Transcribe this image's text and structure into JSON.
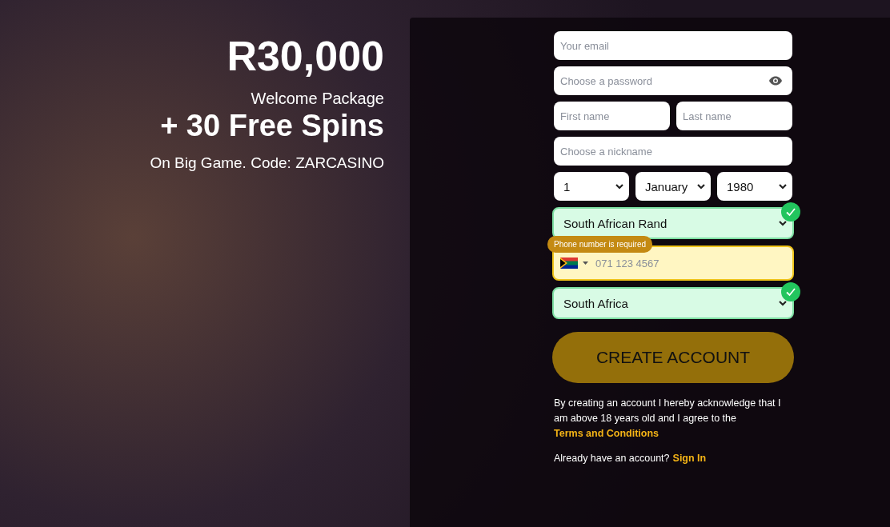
{
  "promo": {
    "amount": "R30,000",
    "subtitle": "Welcome Package",
    "spins": "+ 30 Free Spins",
    "code_line": "On Big Game. Code: ZARCASINO"
  },
  "form": {
    "rows": [
      [
        {
          "kind": "text",
          "placeholder": "Your email"
        }
      ],
      [
        {
          "kind": "password",
          "placeholder": "Choose a password"
        }
      ],
      [
        {
          "kind": "text",
          "placeholder": "First name"
        },
        {
          "kind": "text",
          "placeholder": "Last name"
        }
      ],
      [
        {
          "kind": "text",
          "placeholder": "Choose a nickname"
        }
      ],
      [
        {
          "kind": "select",
          "value": "1",
          "valid": false
        },
        {
          "kind": "select",
          "value": "January",
          "valid": false
        },
        {
          "kind": "select",
          "value": "1980",
          "valid": false
        }
      ],
      [
        {
          "kind": "select",
          "value": "South African Rand",
          "valid": true
        }
      ],
      [
        {
          "kind": "phone",
          "placeholder": "071 123 4567",
          "error": "Phone number is required"
        }
      ],
      [
        {
          "kind": "select",
          "value": "South Africa",
          "valid": true
        }
      ]
    ],
    "submit": "CREATE ACCOUNT",
    "terms": {
      "text": "By creating an account I hereby acknowledge that I am above 18 years old and I agree to the ",
      "link": "Terms and Conditions"
    },
    "signin": {
      "text": "Already have an account?",
      "link": "Sign In"
    }
  }
}
